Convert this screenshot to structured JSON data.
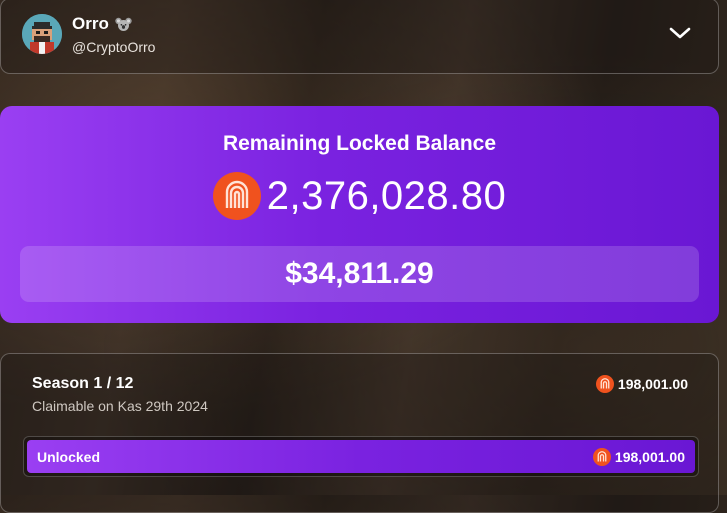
{
  "profile": {
    "name": "Orro",
    "handle": "@CryptoOrro",
    "avatar_icon": "pixel-avatar-icon",
    "badge_icon": "koala-icon",
    "menu_icon": "chevron-down-icon"
  },
  "balance": {
    "title": "Remaining Locked Balance",
    "token_amount": "2,376,028.80",
    "usd_value": "$34,811.29",
    "token_icon": "token-logo-icon"
  },
  "season": {
    "title": "Season 1 / 12",
    "subtitle": "Claimable on Kas 29th 2024",
    "amount": "198,001.00",
    "progress": {
      "label": "Unlocked",
      "amount": "198,001.00",
      "fraction": 1.0
    }
  },
  "colors": {
    "accent_purple": "#8b2ff0",
    "accent_purple_dark": "#6a17d4",
    "token_orange": "#f0521e"
  }
}
